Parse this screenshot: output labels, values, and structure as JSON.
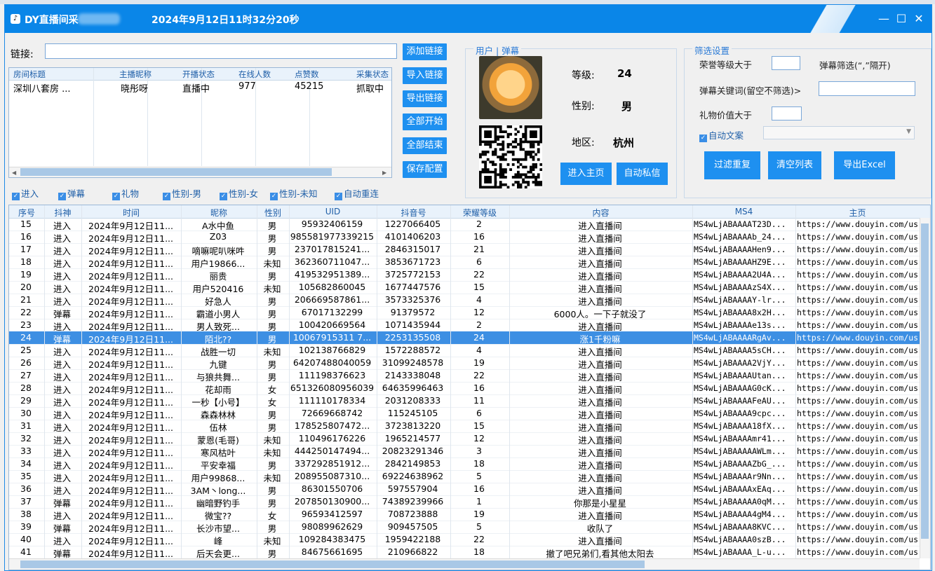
{
  "window": {
    "app_title": "DY直播间采",
    "datetime": "2024年9月12日11时32分20秒",
    "controls": {
      "minimize": "—",
      "maximize": "☐",
      "close": "✕"
    }
  },
  "link": {
    "label": "链接:",
    "value": ""
  },
  "room_table": {
    "headers": [
      "房间标题",
      "主播昵称",
      "开播状态",
      "在线人数",
      "点赞数",
      "采集状态"
    ],
    "rows": [
      [
        "深圳八套房 ...",
        "晓彤呀",
        "直播中",
        "977",
        "45215",
        "抓取中"
      ]
    ]
  },
  "actions": [
    "添加链接",
    "导入链接",
    "导出链接",
    "全部开始",
    "全部结束",
    "保存配置"
  ],
  "checkboxes": [
    "进入",
    "弹幕",
    "礼物",
    "性别-男",
    "性别-女",
    "性别-未知",
    "自动重连"
  ],
  "user_panel": {
    "legend": "用户 | 弹幕",
    "level_label": "等级:",
    "level_value": "24",
    "gender_label": "性别:",
    "gender_value": "男",
    "region_label": "地区:",
    "region_value": "杭州",
    "btn_home": "进入主页",
    "btn_msg": "自动私信"
  },
  "filter_panel": {
    "legend": "筛选设置",
    "honor_label": "荣誉等级大于",
    "danmu_filter_label": "弹幕筛选(“,”隔开)",
    "keyword_label": "弹幕关键词(留空不筛选)>",
    "gift_label": "礼物价值大于",
    "auto_text_label": "自动文案",
    "btn_dedupe": "过滤重复",
    "btn_clear": "清空列表",
    "btn_export": "导出Excel"
  },
  "main_table": {
    "headers": [
      "序号",
      "抖神",
      "时间",
      "昵称",
      "性别",
      "UID",
      "抖音号",
      "荣耀等级",
      "内容",
      "MS4",
      "主页"
    ],
    "selected_index": 9,
    "rows": [
      [
        "15",
        "进入",
        "2024年9月12日11...",
        "A水中鱼",
        "男",
        "95932406159",
        "1227066405",
        "2",
        "进入直播间",
        "MS4wLjABAAAAT23D...",
        "https://www.douyin.com/use"
      ],
      [
        "16",
        "进入",
        "2024年9月12日11...",
        "Z03",
        "男",
        "985581977339215",
        "4101406203",
        "16",
        "进入直播间",
        "MS4wLjABAAAAb_24...",
        "https://www.douyin.com/use"
      ],
      [
        "17",
        "进入",
        "2024年9月12日11...",
        "嘀嘛呢叭咪吽",
        "男",
        "237017815241...",
        "2846315017",
        "21",
        "进入直播间",
        "MS4wLjABAAAAHen9...",
        "https://www.douyin.com/use"
      ],
      [
        "18",
        "进入",
        "2024年9月12日11...",
        "用户19866...",
        "未知",
        "362360711047...",
        "3853671723",
        "6",
        "进入直播间",
        "MS4wLjABAAAAHZ9E...",
        "https://www.douyin.com/use"
      ],
      [
        "19",
        "进入",
        "2024年9月12日11...",
        "丽贵",
        "男",
        "419532951389...",
        "3725772153",
        "22",
        "进入直播间",
        "MS4wLjABAAAA2U4A...",
        "https://www.douyin.com/use"
      ],
      [
        "20",
        "进入",
        "2024年9月12日11...",
        "用户520416",
        "未知",
        "105682860045",
        "1677447576",
        "15",
        "进入直播间",
        "MS4wLjABAAAAzS4X...",
        "https://www.douyin.com/use"
      ],
      [
        "21",
        "进入",
        "2024年9月12日11...",
        "好急人",
        "男",
        "206669587861...",
        "3573325376",
        "4",
        "进入直播间",
        "MS4wLjABAAAAY-lr...",
        "https://www.douyin.com/use"
      ],
      [
        "22",
        "弹幕",
        "2024年9月12日11...",
        "霸道小男人",
        "男",
        "67017132299",
        "91379572",
        "12",
        "6000人。一下子就没了",
        "MS4wLjABAAAA8x2H...",
        "https://www.douyin.com/use"
      ],
      [
        "23",
        "进入",
        "2024年9月12日11...",
        "男人致死...",
        "男",
        "100420669564",
        "1071435944",
        "2",
        "进入直播间",
        "MS4wLjABAAAAe13s...",
        "https://www.douyin.com/use"
      ],
      [
        "24",
        "弹幕",
        "2024年9月12日11...",
        "陌北??",
        "男",
        "10067915311 7...",
        "2253135508",
        "24",
        "涨1千粉嘛",
        "MS4wLjABAAAARgAv...",
        "https://www.douyin.com/use"
      ],
      [
        "25",
        "进入",
        "2024年9月12日11...",
        "战胜一切",
        "未知",
        "102138766829",
        "1572288572",
        "4",
        "进入直播间",
        "MS4wLjABAAAA5sCH...",
        "https://www.douyin.com/use"
      ],
      [
        "26",
        "进入",
        "2024年9月12日11...",
        "九键",
        "男",
        "64207488040059",
        "31099248578",
        "19",
        "进入直播间",
        "MS4wLjABAAAA2VjY...",
        "https://www.douyin.com/use"
      ],
      [
        "27",
        "进入",
        "2024年9月12日11...",
        "与狼共舞...",
        "男",
        "111198376623",
        "2143338048",
        "22",
        "进入直播间",
        "MS4wLjABAAAAUtan...",
        "https://www.douyin.com/use"
      ],
      [
        "28",
        "进入",
        "2024年9月12日11...",
        "花却雨",
        "女",
        "651326080956039",
        "64635996463",
        "16",
        "进入直播间",
        "MS4wLjABAAAAG0cK...",
        "https://www.douyin.com/use"
      ],
      [
        "29",
        "进入",
        "2024年9月12日11...",
        "一秒【小号】",
        "女",
        "111110178334",
        "2031208333",
        "11",
        "进入直播间",
        "MS4wLjABAAAAFeAU...",
        "https://www.douyin.com/use"
      ],
      [
        "30",
        "进入",
        "2024年9月12日11...",
        "森森林林",
        "男",
        "72669668742",
        "115245105",
        "6",
        "进入直播间",
        "MS4wLjABAAAA9cpc...",
        "https://www.douyin.com/use"
      ],
      [
        "31",
        "进入",
        "2024年9月12日11...",
        "伍林",
        "男",
        "178525807472...",
        "3723813220",
        "15",
        "进入直播间",
        "MS4wLjABAAAA18fX...",
        "https://www.douyin.com/use"
      ],
      [
        "32",
        "进入",
        "2024年9月12日11...",
        "蒙恩(毛哥)",
        "未知",
        "110496176226",
        "1965214577",
        "12",
        "进入直播间",
        "MS4wLjABAAAAmr41...",
        "https://www.douyin.com/use"
      ],
      [
        "33",
        "进入",
        "2024年9月12日11...",
        "寒风枯叶",
        "未知",
        "444250147494...",
        "20823291346",
        "3",
        "进入直播间",
        "MS4wLjABAAAAAWLm...",
        "https://www.douyin.com/use"
      ],
      [
        "34",
        "进入",
        "2024年9月12日11...",
        "平安幸福",
        "男",
        "337292851912...",
        "2842149853",
        "18",
        "进入直播间",
        "MS4wLjABAAAAZbG_...",
        "https://www.douyin.com/use"
      ],
      [
        "35",
        "进入",
        "2024年9月12日11...",
        "用户99868...",
        "未知",
        "208955087310...",
        "69224638962",
        "5",
        "进入直播间",
        "MS4wLjABAAAAr9Nn...",
        "https://www.douyin.com/use"
      ],
      [
        "36",
        "进入",
        "2024年9月12日11...",
        "3AM丶long...",
        "男",
        "86301550706",
        "597557904",
        "16",
        "进入直播间",
        "MS4wLjABAAAAxEAq...",
        "https://www.douyin.com/use"
      ],
      [
        "37",
        "弹幕",
        "2024年9月12日11...",
        "幽暗野钓手",
        "男",
        "207850130900...",
        "74389239966",
        "1",
        "你那是小星星",
        "MS4wLjABAAAAA0qM...",
        "https://www.douyin.com/use"
      ],
      [
        "38",
        "进入",
        "2024年9月12日11...",
        "微宝??",
        "女",
        "96593412597",
        "708723888",
        "19",
        "进入直播间",
        "MS4wLjABAAAA4gM4...",
        "https://www.douyin.com/use"
      ],
      [
        "39",
        "弹幕",
        "2024年9月12日11...",
        "长沙市望...",
        "男",
        "98089962629",
        "909457505",
        "5",
        "收队了",
        "MS4wLjABAAAA8KVC...",
        "https://www.douyin.com/use"
      ],
      [
        "40",
        "进入",
        "2024年9月12日11...",
        "峰",
        "未知",
        "109284383475",
        "1959422188",
        "22",
        "进入直播间",
        "MS4wLjABAAAA0szB...",
        "https://www.douyin.com/use"
      ],
      [
        "41",
        "弹幕",
        "2024年9月12日11...",
        "后天会更...",
        "男",
        "84675661695",
        "210966822",
        "18",
        "撤了吧兄弟们,看其他太阳去",
        "MS4wLjABAAAA_L-u...",
        "https://www.douyin.com/use"
      ]
    ]
  }
}
